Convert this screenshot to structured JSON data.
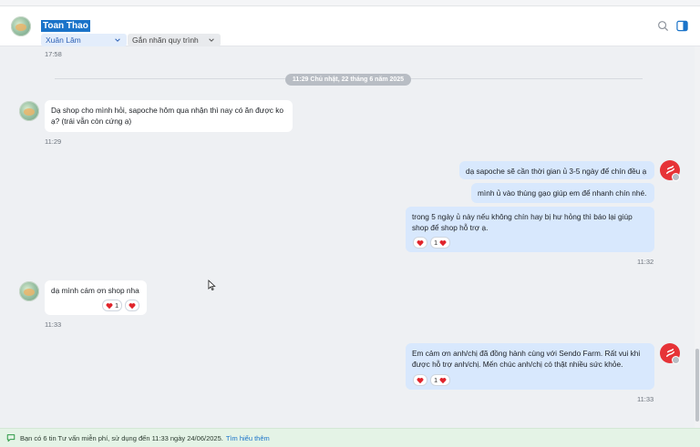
{
  "header": {
    "customer_name": "Toan Thao",
    "assignee_label": "Xuân Lâm",
    "tag_label": "Gắn nhãn quy trình",
    "icons": [
      "search-icon",
      "side-panel-icon"
    ]
  },
  "conversation": {
    "first_time": "17:58",
    "date_divider": "11:29 Chủ nhật, 22 tháng 6 năm 2025",
    "messages": [
      {
        "sender": "customer",
        "text": "Dạ shop cho mình hỏi, sapoche hôm qua nhận thì nay có ăn được ko ạ? (trái vẫn còn cứng ạ)",
        "time": "11:29"
      },
      {
        "sender": "shop",
        "text": "dạ sapoche sẽ cần thời gian ủ 3-5 ngày để chín đều ạ"
      },
      {
        "sender": "shop",
        "text": "mình ủ vào thùng gạo giúp em để nhanh chín nhé."
      },
      {
        "sender": "shop",
        "text": "trong 5 ngày ủ này nếu không chín hay bị hư hỏng thì báo lại giúp shop để shop hỗ trợ ạ.",
        "reaction_count": "1",
        "time": "11:32"
      },
      {
        "sender": "customer",
        "text": "dạ mình cám ơn shop nha",
        "reaction_count": "1",
        "time": "11:33"
      },
      {
        "sender": "shop",
        "text": "Em cảm ơn anh/chị đã đồng hành cùng với Sendo Farm. Rất vui khi được hỗ trợ anh/chị. Mến chúc anh/chị có thật nhiều sức khỏe.",
        "reaction_count": "1",
        "time": "11:33"
      }
    ]
  },
  "footer": {
    "notice": "Bạn có 6 tin Tư vấn miễn phí, sử dụng đến 11:33 ngày 24/06/2025.",
    "link": "Tìm hiểu thêm"
  },
  "colors": {
    "accent": "#1a73c9",
    "heart": "#e0242b",
    "shop_avatar": "#e63337",
    "outgoing_bubble": "#d8e8fd",
    "footer_bg": "#e4f3e6"
  }
}
